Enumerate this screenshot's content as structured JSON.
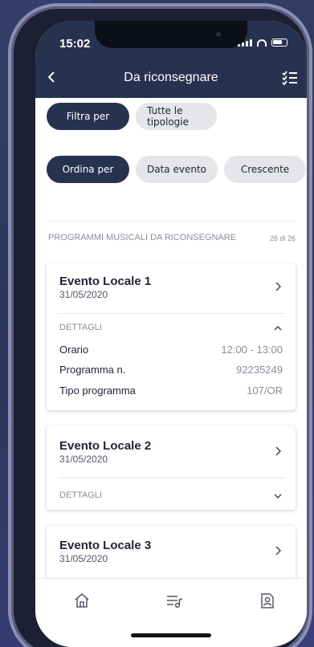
{
  "status": {
    "time": "15:02"
  },
  "header": {
    "title": "Da riconsegnare"
  },
  "filters": {
    "filter_label": "Filtra per",
    "filter_value": "Tutte le tipologie",
    "order_label": "Ordina per",
    "order_field": "Data evento",
    "order_direction": "Crescente"
  },
  "section": {
    "title": "PROGRAMMI MUSICALI DA RICONSEGNARE",
    "count": "26 di 26"
  },
  "events": [
    {
      "title": "Evento Locale 1",
      "date": "31/05/2020",
      "details_label": "DETTAGLI",
      "expanded": true,
      "details": [
        {
          "label": "Orario",
          "value": "12:00 - 13:00"
        },
        {
          "label": "Programma n.",
          "value": "92235249"
        },
        {
          "label": "Tipo programma",
          "value": "107/OR"
        }
      ]
    },
    {
      "title": "Evento Locale 2",
      "date": "31/05/2020",
      "details_label": "DETTAGLI",
      "expanded": false
    },
    {
      "title": "Evento Locale 3",
      "date": "31/05/2020"
    }
  ],
  "tabs": [
    "home-icon",
    "playlist-icon",
    "user-document-icon"
  ],
  "colors": {
    "primary": "#27324f",
    "pill_light": "#e5e6ea"
  }
}
